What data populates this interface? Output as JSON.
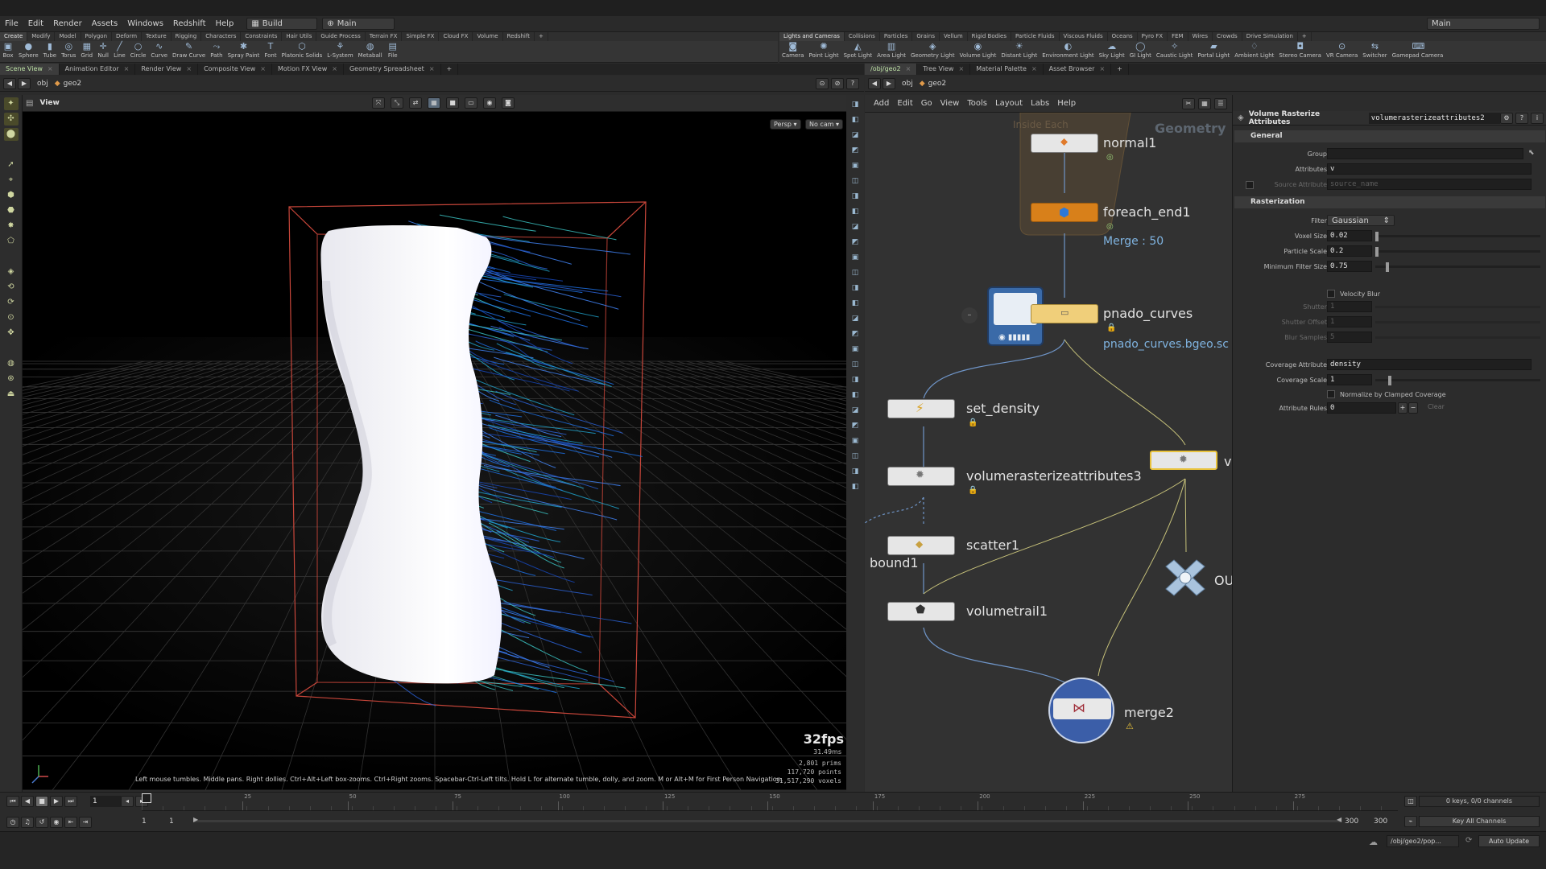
{
  "menubar": {
    "items": [
      "File",
      "Edit",
      "Render",
      "Assets",
      "Windows",
      "Redshift",
      "Help"
    ],
    "desktop": "Build",
    "workspace": "Main",
    "right_workspace": "Main"
  },
  "shelf_left": {
    "tabs": [
      "Create",
      "Modify",
      "Model",
      "Polygon",
      "Deform",
      "Texture",
      "Rigging",
      "Characters",
      "Constraints",
      "Hair Utils",
      "Guide Process",
      "Terrain FX",
      "Simple FX",
      "Cloud FX",
      "Volume",
      "Redshift"
    ],
    "active_tab": 0,
    "tools": [
      {
        "label": "Box",
        "icon": "box-icon",
        "glyph": "▣"
      },
      {
        "label": "Sphere",
        "icon": "sphere-icon",
        "glyph": "●"
      },
      {
        "label": "Tube",
        "icon": "tube-icon",
        "glyph": "▮"
      },
      {
        "label": "Torus",
        "icon": "torus-icon",
        "glyph": "◎"
      },
      {
        "label": "Grid",
        "icon": "grid-icon",
        "glyph": "▦"
      },
      {
        "label": "Null",
        "icon": "null-icon",
        "glyph": "✛"
      },
      {
        "label": "Line",
        "icon": "line-icon",
        "glyph": "╱"
      },
      {
        "label": "Circle",
        "icon": "circle-icon",
        "glyph": "○"
      },
      {
        "label": "Curve",
        "icon": "curve-icon",
        "glyph": "∿"
      },
      {
        "label": "Draw Curve",
        "icon": "draw-curve-icon",
        "glyph": "✎"
      },
      {
        "label": "Path",
        "icon": "path-icon",
        "glyph": "⤳"
      },
      {
        "label": "Spray Paint",
        "icon": "spray-paint-icon",
        "glyph": "✱"
      },
      {
        "label": "Font",
        "icon": "font-icon",
        "glyph": "T"
      },
      {
        "label": "Platonic Solids",
        "icon": "platonic-solids-icon",
        "glyph": "⬡"
      },
      {
        "label": "L-System",
        "icon": "l-system-icon",
        "glyph": "⚘"
      },
      {
        "label": "Metaball",
        "icon": "metaball-icon",
        "glyph": "◍"
      },
      {
        "label": "File",
        "icon": "file-icon",
        "glyph": "▤"
      }
    ]
  },
  "shelf_right": {
    "tabs": [
      "Lights and Cameras",
      "Collisions",
      "Particles",
      "Grains",
      "Vellum",
      "Rigid Bodies",
      "Particle Fluids",
      "Viscous Fluids",
      "Oceans",
      "Pyro FX",
      "FEM",
      "Wires",
      "Crowds",
      "Drive Simulation"
    ],
    "active_tab": 0,
    "tools": [
      {
        "label": "Camera",
        "icon": "camera-icon",
        "glyph": "◙"
      },
      {
        "label": "Point Light",
        "icon": "point-light-icon",
        "glyph": "✺"
      },
      {
        "label": "Spot Light",
        "icon": "spot-light-icon",
        "glyph": "◭"
      },
      {
        "label": "Area Light",
        "icon": "area-light-icon",
        "glyph": "▥"
      },
      {
        "label": "Geometry Light",
        "icon": "geometry-light-icon",
        "glyph": "◈"
      },
      {
        "label": "Volume Light",
        "icon": "volume-light-icon",
        "glyph": "◉"
      },
      {
        "label": "Distant Light",
        "icon": "distant-light-icon",
        "glyph": "☀"
      },
      {
        "label": "Environment Light",
        "icon": "environment-light-icon",
        "glyph": "◐"
      },
      {
        "label": "Sky Light",
        "icon": "sky-light-icon",
        "glyph": "☁"
      },
      {
        "label": "GI Light",
        "icon": "gi-light-icon",
        "glyph": "◯"
      },
      {
        "label": "Caustic Light",
        "icon": "caustic-light-icon",
        "glyph": "✧"
      },
      {
        "label": "Portal Light",
        "icon": "portal-light-icon",
        "glyph": "▰"
      },
      {
        "label": "Ambient Light",
        "icon": "ambient-light-icon",
        "glyph": "♢"
      },
      {
        "label": "Stereo Camera",
        "icon": "stereo-camera-icon",
        "glyph": "◘"
      },
      {
        "label": "VR Camera",
        "icon": "vr-camera-icon",
        "glyph": "⊙"
      },
      {
        "label": "Switcher",
        "icon": "switcher-icon",
        "glyph": "⇆"
      },
      {
        "label": "Gamepad Camera",
        "icon": "gamepad-camera-icon",
        "glyph": "⌨"
      }
    ]
  },
  "left_panel": {
    "tabs": [
      "Scene View",
      "Animation Editor",
      "Render View",
      "Composite View",
      "Motion FX View",
      "Geometry Spreadsheet"
    ],
    "active_tab": 0,
    "path": [
      "obj",
      "geo2"
    ],
    "view_label": "View",
    "persp_label": "Persp",
    "cam_label": "No cam",
    "fps": "32fps",
    "frame_time": "31.49ms",
    "stats": [
      "2,801  prims",
      "117,720  points",
      "31,517,290 voxels"
    ],
    "help_text": "Left mouse tumbles. Middle pans. Right dollies. Ctrl+Alt+Left box-zooms. Ctrl+Right zooms. Spacebar-Ctrl-Left tilts. Hold L for alternate tumble, dolly, and zoom.    M or Alt+M for First Person Navigation."
  },
  "right_panel": {
    "tabs": [
      "/obj/geo2",
      "Tree View",
      "Material Palette",
      "Asset Browser"
    ],
    "active_tab": 0,
    "path": [
      "obj",
      "geo2"
    ],
    "menus": [
      "Add",
      "Edit",
      "Go",
      "View",
      "Tools",
      "Layout",
      "Labs",
      "Help"
    ]
  },
  "network": {
    "context_label": "Geometry",
    "block_label": "Inside Each",
    "nodes": {
      "normal1": "normal1",
      "foreach_end1": "foreach_end1",
      "foreach_sub": "Merge : 50",
      "pnado_curves": "pnado_curves",
      "pnado_sub": "pnado_curves.bgeo.sc",
      "set_density": "set_density",
      "vra3": "volumerasterizeattributes3",
      "bound1": "bound1",
      "scatter1": "scatter1",
      "volumetrail1": "volumetrail1",
      "merge2": "merge2",
      "vra2_partial": "ve",
      "out_partial": "OU"
    }
  },
  "params": {
    "node_type": "Volume Rasterize Attributes",
    "node_name": "volumerasterizeattributes2",
    "sections": {
      "general": "General",
      "rasterization": "Rasterization"
    },
    "group_label": "Group",
    "group_value": "",
    "attributes_label": "Attributes",
    "attributes_value": "v",
    "source_attribute_label": "Source Attribute",
    "source_attribute_value": "source_name",
    "filter_label": "Filter",
    "filter_value": "Gaussian",
    "voxel_size_label": "Voxel Size",
    "voxel_size": "0.02",
    "particle_scale_label": "Particle Scale",
    "particle_scale": "0.2",
    "min_filter_label": "Minimum Filter Size",
    "min_filter": "0.75",
    "velocity_blur_label": "Velocity Blur",
    "shutter_label": "Shutter",
    "shutter": "1",
    "shutter_offset_label": "Shutter Offset",
    "shutter_offset": "1",
    "blur_samples_label": "Blur Samples",
    "blur_samples": "5",
    "coverage_attr_label": "Coverage Attribute",
    "coverage_attr": "density",
    "coverage_scale_label": "Coverage Scale",
    "coverage_scale": "1",
    "normalize_label": "Normalize by Clamped Coverage",
    "attr_rules_label": "Attribute Rules",
    "attr_rules": "0",
    "clear_label": "Clear"
  },
  "timeline": {
    "ticks": [
      "1",
      "25",
      "50",
      "75",
      "100",
      "125",
      "150",
      "175",
      "200",
      "225",
      "250",
      "275"
    ],
    "current_frame": "1",
    "frame_field": "1",
    "range_start": "1",
    "range_start2": "1",
    "range_end": "300",
    "range_end2": "300",
    "keys_info": "0 keys, 0/0 channels",
    "key_all": "Key All Channels"
  },
  "status": {
    "path": "/obj/geo2/pop...",
    "update_mode": "Auto Update"
  },
  "colors": {
    "accent_green": "#bde1a5",
    "node_selected": "#e8c23c",
    "foreach_orange": "#d8801a",
    "link_blue": "#7fb3e0",
    "volume_blue": "#1d6fe0"
  }
}
